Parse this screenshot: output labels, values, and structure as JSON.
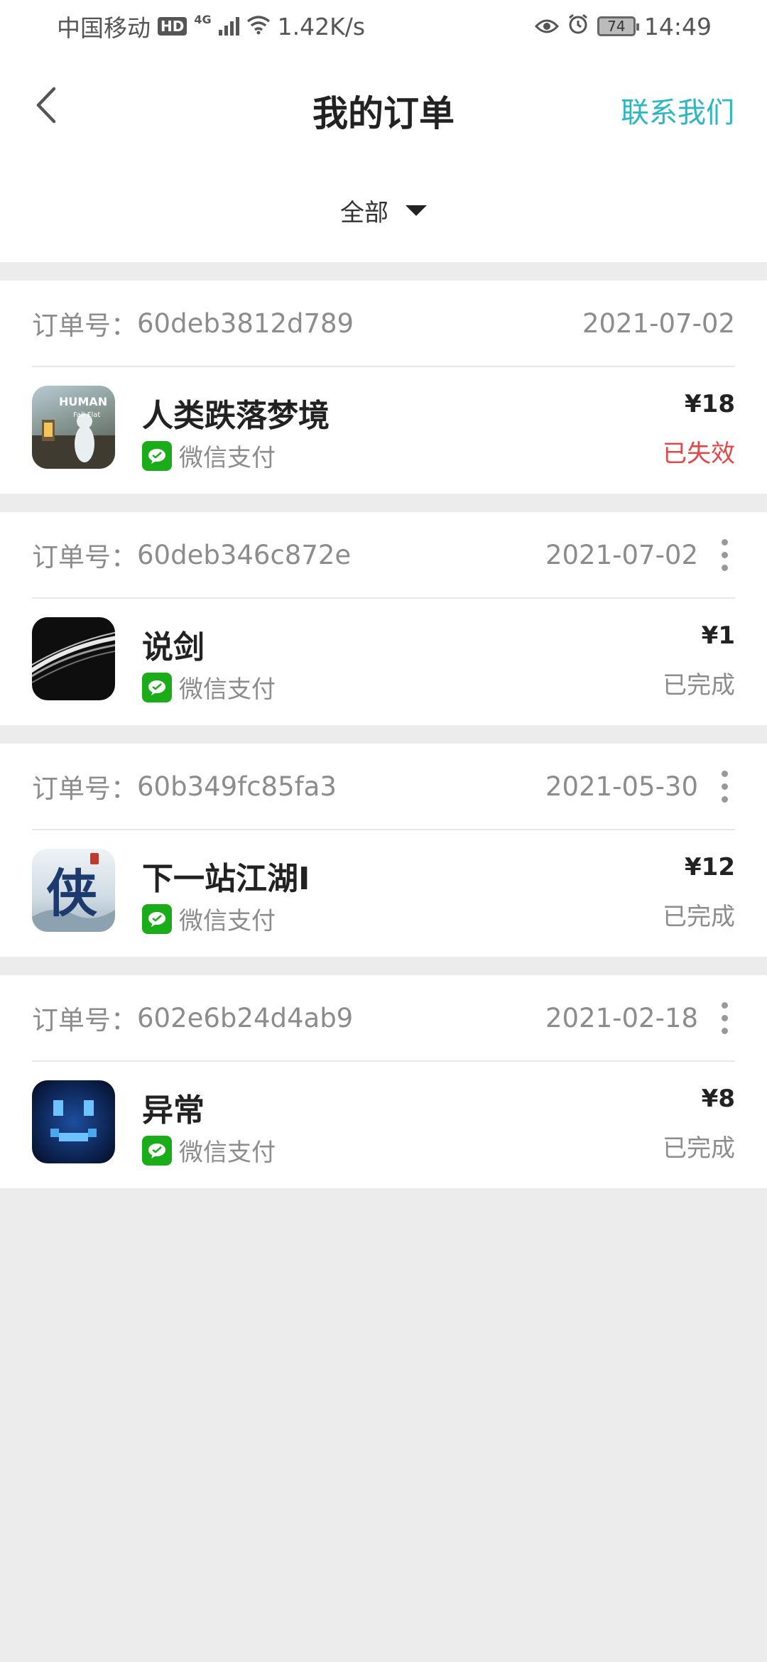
{
  "status_bar": {
    "carrier": "中国移动",
    "hd": "HD",
    "network": "4G",
    "speed": "1.42K/s",
    "battery": "74",
    "time": "14:49"
  },
  "header": {
    "title": "我的订单",
    "contact": "联系我们",
    "back_icon": "chevron-left-icon"
  },
  "filter": {
    "selected": "全部"
  },
  "colors": {
    "accent": "#2bb6c4",
    "expired": "#e04848",
    "wechat": "#1aad19"
  },
  "orders": [
    {
      "order_label": "订单号：",
      "order_no": "60deb3812d789",
      "date": "2021-07-02",
      "game": "人类跌落梦境",
      "icon_text": "HUMAN",
      "payment": "微信支付",
      "price": "¥18",
      "status": "已失效",
      "has_more": false
    },
    {
      "order_label": "订单号：",
      "order_no": "60deb346c872e",
      "date": "2021-07-02",
      "game": "说剑",
      "payment": "微信支付",
      "price": "¥1",
      "status": "已完成",
      "has_more": true
    },
    {
      "order_label": "订单号：",
      "order_no": "60b349fc85fa3",
      "date": "2021-05-30",
      "game": "下一站江湖Ⅰ",
      "icon_text": "侠",
      "payment": "微信支付",
      "price": "¥12",
      "status": "已完成",
      "has_more": true
    },
    {
      "order_label": "订单号：",
      "order_no": "602e6b24d4ab9",
      "date": "2021-02-18",
      "game": "异常",
      "payment": "微信支付",
      "price": "¥8",
      "status": "已完成",
      "has_more": true
    }
  ]
}
